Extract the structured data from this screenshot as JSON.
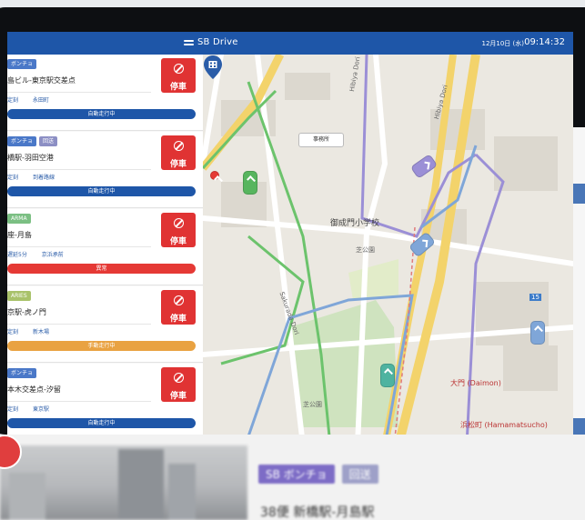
{
  "status_bar": {
    "app_title": "SB Drive",
    "date": "12月10日 (水)",
    "time": "09:14:32"
  },
  "vehicles": [
    {
      "tags": [
        {
          "text": "ボンチョ",
          "color": "#4a78c8"
        }
      ],
      "route": "島ビル-東京駅交差点",
      "meta": [
        "定刻",
        "永田町"
      ],
      "stop_label": "停車",
      "mode": "自動走行中",
      "mode_color": "#1e56a8"
    },
    {
      "tags": [
        {
          "text": "ボンチョ",
          "color": "#4a78c8"
        },
        {
          "text": "回送",
          "color": "#8c8fc4"
        }
      ],
      "route": "橋駅-羽田空港",
      "meta": [
        "定刻",
        "到着路線"
      ],
      "stop_label": "停車",
      "mode": "自動走行中",
      "mode_color": "#1e56a8"
    },
    {
      "tags": [
        {
          "text": "ARMA",
          "color": "#7bbf83"
        }
      ],
      "route": "座-月島",
      "meta": [
        "遅延5分",
        "京浜承前"
      ],
      "stop_label": "停車",
      "mode": "異常",
      "mode_color": "#e53935"
    },
    {
      "tags": [
        {
          "text": "ARIES",
          "color": "#a9c26a"
        }
      ],
      "route": "京駅-虎ノ門",
      "meta": [
        "定刻",
        "新木場"
      ],
      "stop_label": "停車",
      "mode": "手動走行中",
      "mode_color": "#e9a241"
    },
    {
      "tags": [
        {
          "text": "ボンチョ",
          "color": "#4a78c8"
        }
      ],
      "route": "本木交差点-汐留",
      "meta": [
        "定刻",
        "東京駅"
      ],
      "stop_label": "停車",
      "mode": "自動走行中",
      "mode_color": "#1e56a8"
    }
  ],
  "map": {
    "callout": "事務所",
    "school": "御成門小学校",
    "park1": "芝公園",
    "park2": "芝公園",
    "road1": "Hibiya Dori",
    "road2": "Hibiya Dori",
    "road3": "Sakurada Dori",
    "station1": "大門 (Daimon)",
    "station2": "浜松町 (Hamamatsucho)",
    "sign": "15",
    "colors": {
      "green_route": "#6cc36c",
      "purple_route": "#9b8fd6",
      "blue_route": "#7fa6d8"
    }
  },
  "background": {
    "tag1": "SB ボンチョ",
    "tag2": "回送",
    "route": "38便 新橋駅-月島駅"
  }
}
